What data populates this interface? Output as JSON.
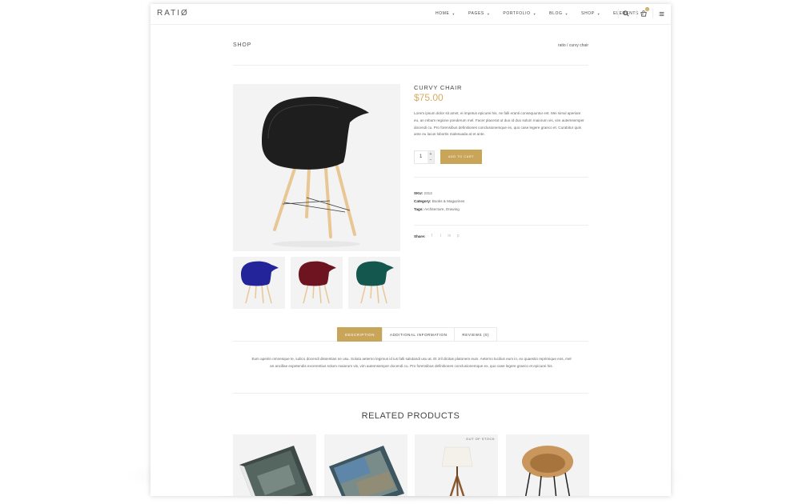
{
  "brand": {
    "logo": "RATIØ"
  },
  "nav": [
    {
      "label": "HOME"
    },
    {
      "label": "PAGES"
    },
    {
      "label": "PORTFOLIO"
    },
    {
      "label": "BLOG"
    },
    {
      "label": "SHOP"
    },
    {
      "label": "ELEMENTS"
    }
  ],
  "cart": {
    "count": "0"
  },
  "page": {
    "title": "SHOP",
    "breadcrumb_home": "ratio",
    "breadcrumb_sep": "/",
    "breadcrumb_current": "curvy chair"
  },
  "product": {
    "title": "CURVY CHAIR",
    "price": "$75.00",
    "description": "Lorem ipsum dolor sit amet, ei impetus epicurei his, ne falli eranti consequuntur est. Mei simul aperiam eu, an rebum regione ponderum mel. Facer placerat ut duo id duo solum maiorum vis, vim autemsemper docendi cu. Pro forensibus definitiones conclusionemque ex, quo case legere graeco et. Curabitur quis ante eu lacus lobortis malesuada at et ante.",
    "quantity": "1",
    "add_to_cart": "ADD TO CART",
    "sku_label": "SKU:",
    "sku": "2313",
    "category_label": "Category:",
    "category": "Books & Magazines",
    "tags_label": "Tags:",
    "tags": "Architecture, Drawing",
    "share_label": "Share:",
    "colors": {
      "main": "#1e1e1e",
      "blue": "#23239a",
      "red": "#6e1420",
      "green": "#14574e",
      "wood": "#e8c795",
      "accent": "#c9a55a",
      "price": "#d6ad60"
    }
  },
  "tabs": [
    {
      "label": "DESCRIPTION",
      "active": true
    },
    {
      "label": "ADDITIONAL INFORMATION"
    },
    {
      "label": "REVIEWS (0)"
    }
  ],
  "tab_content": "Eum apeirin omnesque te, iudico docendi dissentias ne usu. Soluta aeterno legimus id ius falli salutandi usu at. Et zril dicitas platonem eum. Aeterno lucilius eum in, ex quaestio reprimique eos, mel an ancillae expetendis excerentius solum maiorum vis, vim autemsemper docendi cu. Pro forensibus definitiones conclusionemque ex, quo case legere graeco et epicurei his.",
  "related": {
    "title": "RELATED PRODUCTS",
    "items": [
      {
        "badge": ""
      },
      {
        "badge": ""
      },
      {
        "badge": "OUT OF STOCK"
      },
      {
        "badge": ""
      }
    ]
  }
}
